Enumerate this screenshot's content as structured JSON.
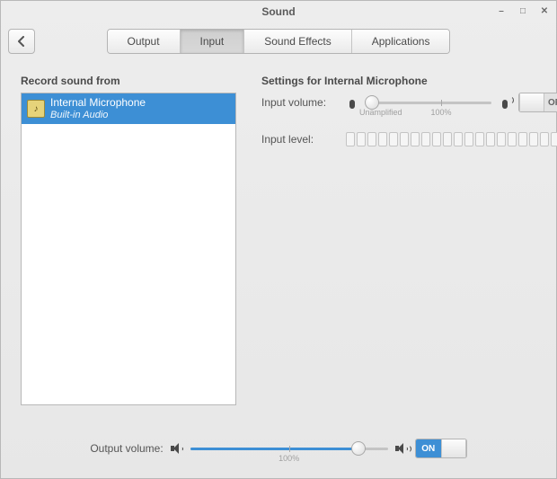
{
  "window": {
    "title": "Sound"
  },
  "tabs": {
    "output": "Output",
    "input": "Input",
    "sound_effects": "Sound Effects",
    "applications": "Applications",
    "active": "input"
  },
  "left": {
    "heading": "Record sound from",
    "devices": [
      {
        "name": "Internal Microphone",
        "sub": "Built-in Audio",
        "selected": true
      }
    ]
  },
  "right": {
    "heading": "Settings for Internal Microphone",
    "input_volume_label": "Input volume:",
    "input_volume_percent": 5,
    "tick_unamplified": "Unamplified",
    "tick_100": "100%",
    "input_toggle_state": "OFF",
    "input_level_label": "Input level:",
    "level_segments": 21
  },
  "footer": {
    "label": "Output volume:",
    "percent": 85,
    "tick_100": "100%",
    "toggle_state": "ON"
  }
}
